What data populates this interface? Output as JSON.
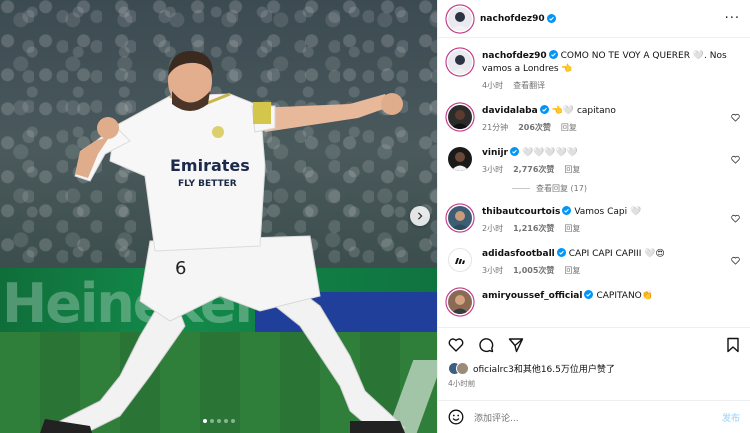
{
  "post": {
    "author": "nachofdez90",
    "caption_username": "nachofdez90",
    "caption_text": "COMO NO TE VOY A QUERER 🤍. Nos vamos a Londres 👈",
    "caption_time": "4小时",
    "caption_translate": "查看翻译",
    "photo_ad_text": "Heinekeı",
    "carousel_slides": 5,
    "carousel_active": 1
  },
  "comments": [
    {
      "username": "davidalaba",
      "verified": true,
      "text": "👈🤍 capitano",
      "time": "21分钟",
      "likes": "206次赞",
      "reply": "回复",
      "avatar_color": "#2b2b2b"
    },
    {
      "username": "vinijr",
      "verified": true,
      "text": "🤍🤍🤍🤍🤍",
      "time": "3小时",
      "likes": "2,776次赞",
      "reply": "回复",
      "avatar_color": "#1a1a1a",
      "view_replies": "查看回复 (17)"
    },
    {
      "username": "thibautcourtois",
      "verified": true,
      "text": "Vamos Capi 🤍",
      "time": "2小时",
      "likes": "1,216次赞",
      "reply": "回复",
      "avatar_color": "#3d5d74"
    },
    {
      "username": "adidasfootball",
      "verified": true,
      "text": "CAPI CAPI CAPIII 🤍😍",
      "time": "3小时",
      "likes": "1,005次赞",
      "reply": "回复",
      "avatar_color": "#ffffff"
    },
    {
      "username": "amiryoussef_official",
      "verified": true,
      "text": "CAPITANO👏",
      "time": "",
      "likes": "",
      "reply": "",
      "avatar_color": "#8a6a55"
    }
  ],
  "actions": {
    "liked_by": "oficialrc3和其他16.5万位用户赞了",
    "time": "4小时前"
  },
  "add_comment": {
    "placeholder": "添加评论...",
    "post_label": "发布"
  },
  "colors": {
    "verified_blue": "#0095f6",
    "muted": "#737373",
    "ring": "#c13584",
    "jersey_accent": "#d4c64a"
  },
  "icons": [
    "heart-icon",
    "comment-icon",
    "share-icon",
    "bookmark-icon",
    "emoji-icon",
    "more-icon",
    "verified-icon",
    "chevron-right-icon"
  ]
}
